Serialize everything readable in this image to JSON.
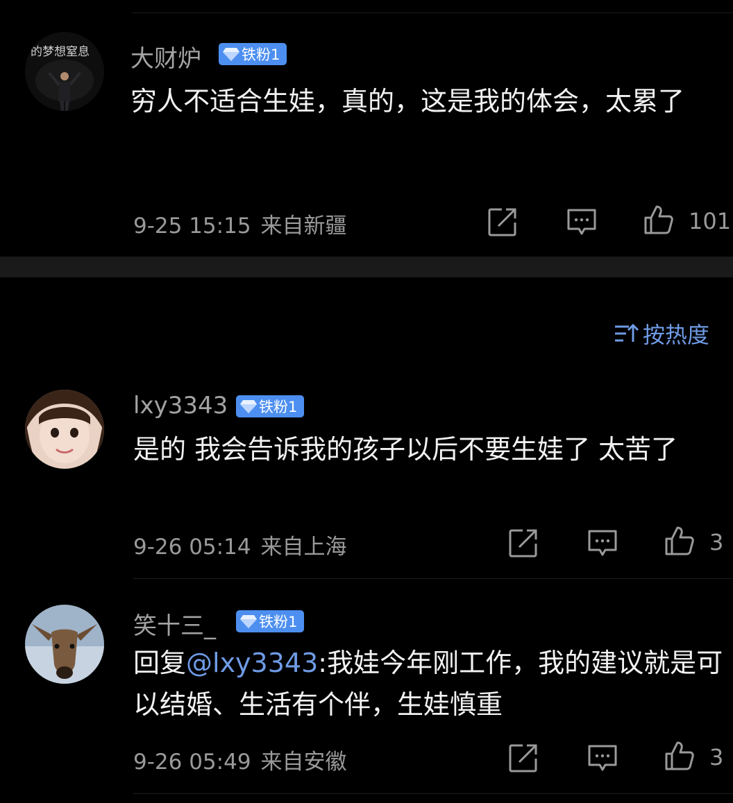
{
  "comments": [
    {
      "user": "大财炉",
      "badge": "铁粉1",
      "avatar_caption": "的梦想窒息",
      "text": "穷人不适合生娃，真的，这是我的体会，太累了",
      "time": "9-25 15:15",
      "location": "来自新疆",
      "likes": "101"
    },
    {
      "user": "lxy3343",
      "badge": "铁粉1",
      "text": "是的 我会告诉我的孩子以后不要生娃了 太苦了",
      "time": "9-26 05:14",
      "location": "来自上海",
      "likes": "3"
    },
    {
      "user": "笑十三_",
      "badge": "铁粉1",
      "reply_prefix": "回复",
      "mention": "@lxy3343",
      "reply_text": ":我娃今年刚工作，我的建议就是可以结婚、生活有个伴，生娃慎重",
      "time": "9-26 05:49",
      "location": "来自安徽",
      "likes": "3"
    }
  ],
  "sort": {
    "label": "按热度",
    "icon": "sort-icon"
  },
  "icons": {
    "share": "share-icon",
    "comment": "comment-icon",
    "like": "like-icon",
    "badge": "diamond-icon"
  },
  "colors": {
    "background": "#000000",
    "badge": "#4d8ff0",
    "link": "#6f9be6",
    "meta": "#9a9a9a"
  }
}
